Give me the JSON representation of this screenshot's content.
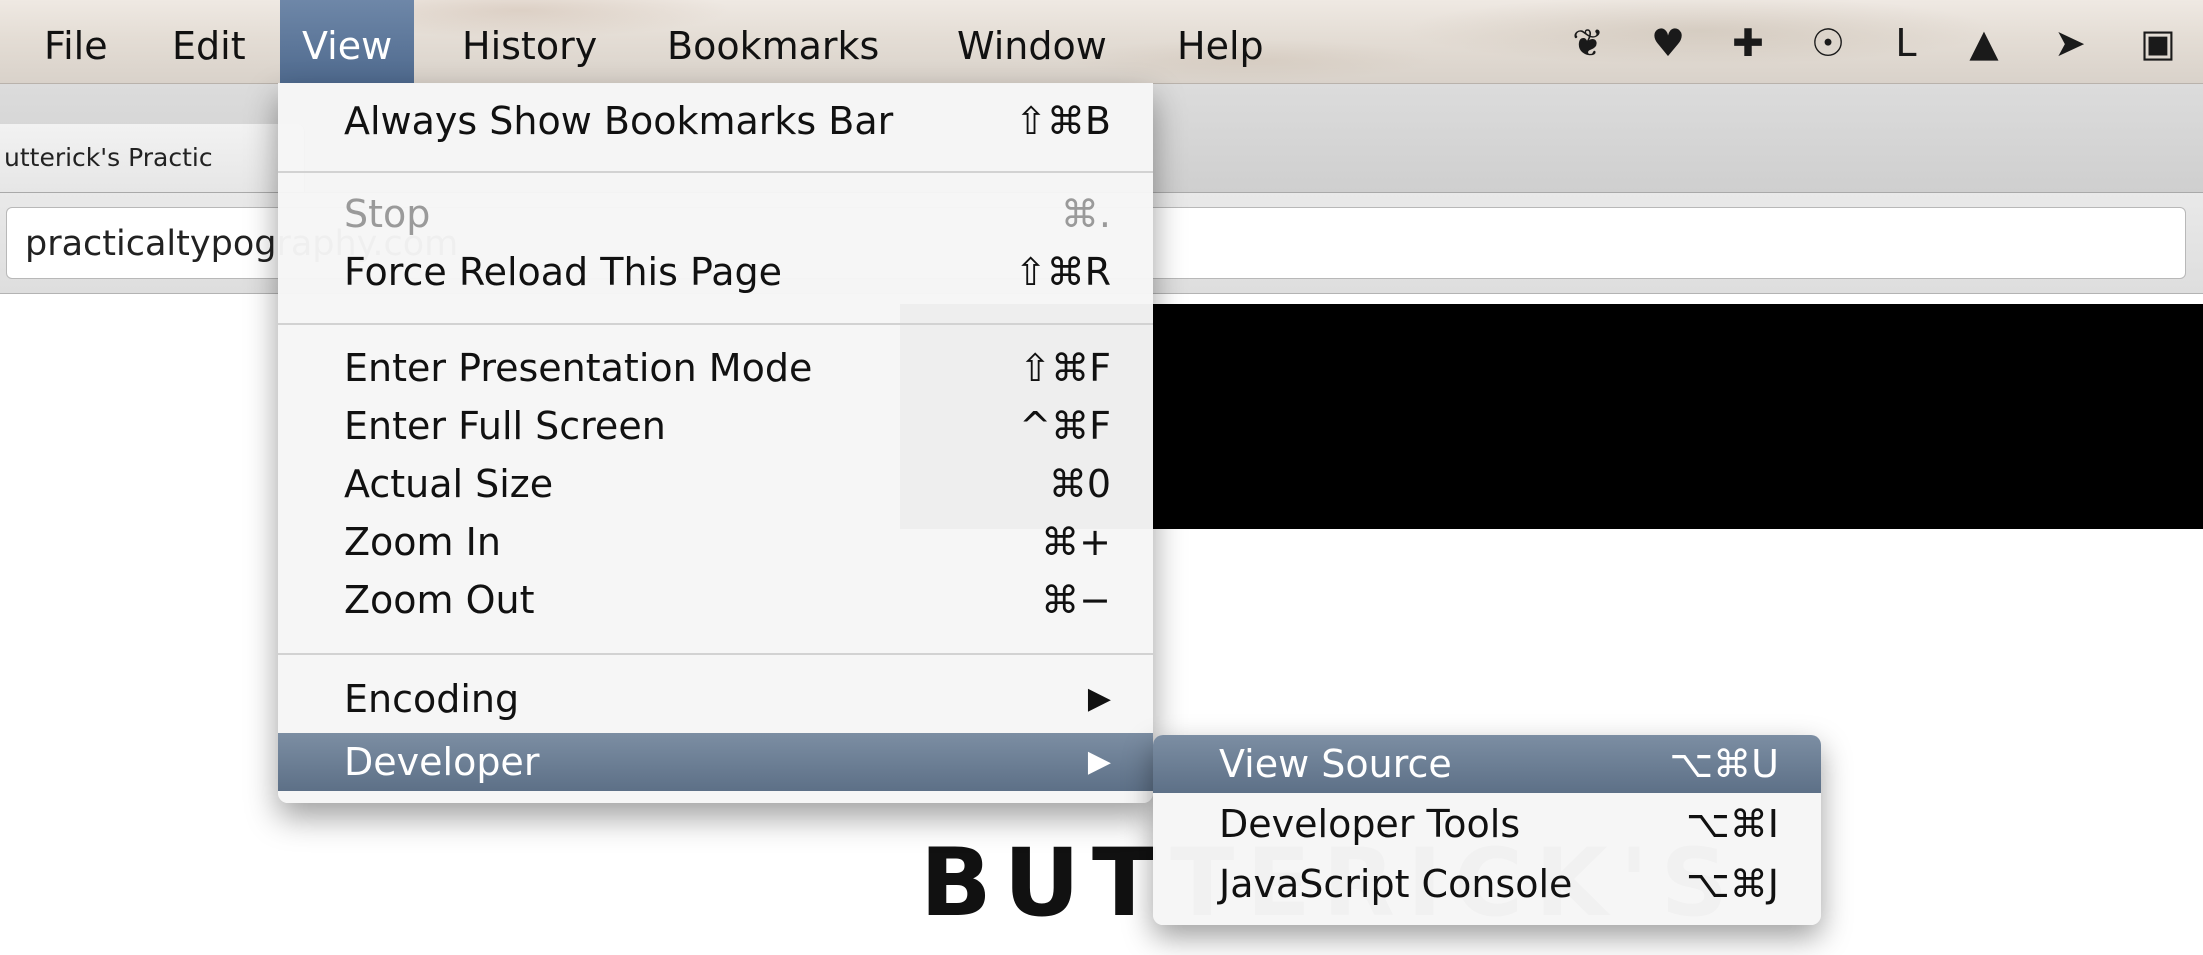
{
  "menubar": {
    "items": [
      {
        "label": "File"
      },
      {
        "label": "Edit"
      },
      {
        "label": "View",
        "active": true
      },
      {
        "label": "History"
      },
      {
        "label": "Bookmarks"
      },
      {
        "label": "Window"
      },
      {
        "label": "Help"
      }
    ],
    "status_icons": [
      {
        "name": "evernote-icon",
        "glyph": "❦"
      },
      {
        "name": "pocket-icon",
        "glyph": "♥"
      },
      {
        "name": "plus-cross-icon",
        "glyph": "✚"
      },
      {
        "name": "circle-logo-icon",
        "glyph": "☉"
      },
      {
        "name": "l-letter-icon",
        "glyph": "L"
      },
      {
        "name": "google-drive-icon",
        "glyph": "▲"
      },
      {
        "name": "arrow-forward-icon",
        "glyph": "➤"
      },
      {
        "name": "bag-icon",
        "glyph": "▣"
      }
    ]
  },
  "tab": {
    "title": "utterick's Practic"
  },
  "address_bar": {
    "value": "practicaltypography.com"
  },
  "page": {
    "heading": "BUTTERICK'S"
  },
  "view_menu": {
    "items": [
      {
        "label": "Always Show Bookmarks Bar",
        "shortcut": "⇧⌘B"
      },
      {
        "label": "Stop",
        "shortcut": "⌘.",
        "disabled": true
      },
      {
        "label": "Force Reload This Page",
        "shortcut": "⇧⌘R"
      },
      {
        "label": "Enter Presentation Mode",
        "shortcut": "⇧⌘F"
      },
      {
        "label": "Enter Full Screen",
        "shortcut": "^⌘F"
      },
      {
        "label": "Actual Size",
        "shortcut": "⌘0"
      },
      {
        "label": "Zoom In",
        "shortcut": "⌘+"
      },
      {
        "label": "Zoom Out",
        "shortcut": "⌘−"
      },
      {
        "label": "Encoding",
        "shortcut": "▶"
      },
      {
        "label": "Developer",
        "shortcut": "▶",
        "highlighted": true
      }
    ]
  },
  "developer_submenu": {
    "items": [
      {
        "label": "View Source",
        "shortcut": "⌥⌘U",
        "highlighted": true
      },
      {
        "label": "Developer Tools",
        "shortcut": "⌥⌘I"
      },
      {
        "label": "JavaScript Console",
        "shortcut": "⌥⌘J"
      }
    ]
  }
}
